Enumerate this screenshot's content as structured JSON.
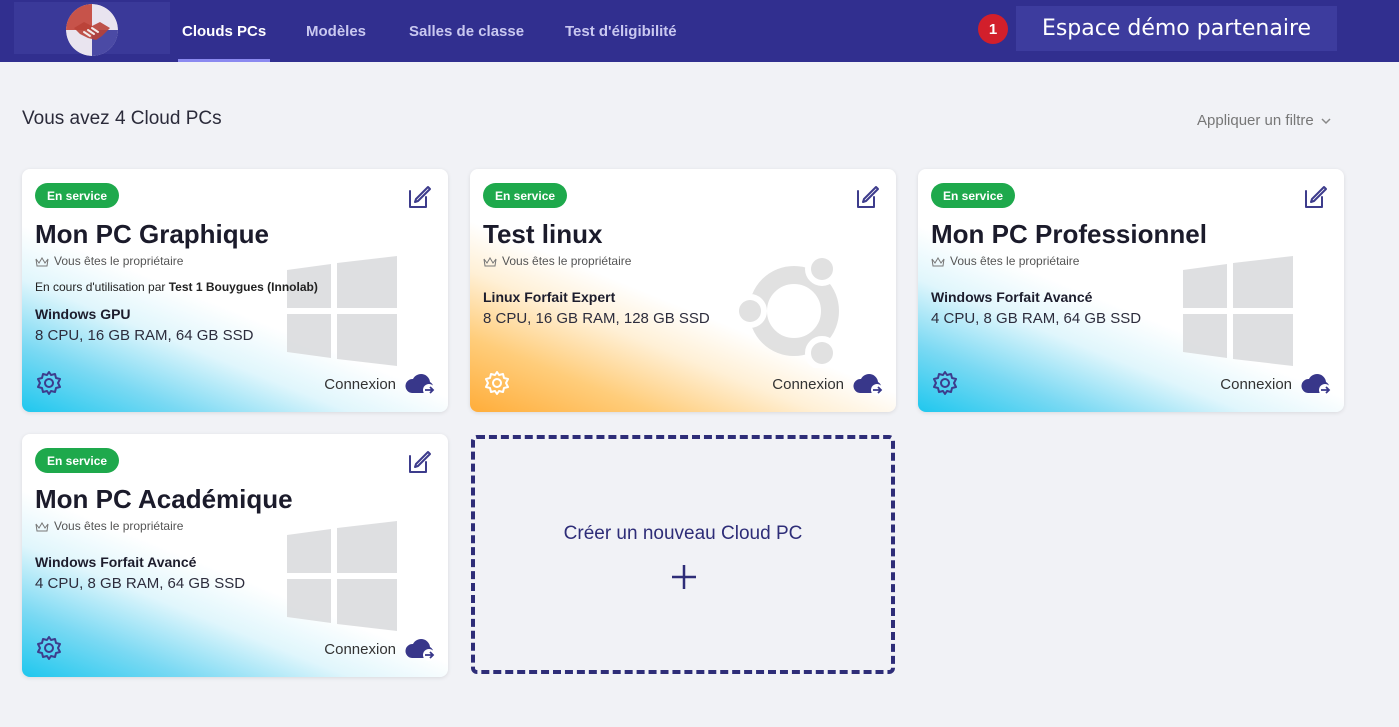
{
  "nav": {
    "items": [
      "Clouds PCs",
      "Modèles",
      "Salles de classe",
      "Test d'éligibilité"
    ],
    "active": 0,
    "notification_count": "1",
    "space_label": "Espace démo partenaire"
  },
  "main": {
    "count_text": "Vous avez 4 Cloud PCs",
    "filter_label": "Appliquer un filtre"
  },
  "cards": [
    {
      "status": "En service",
      "name": "Mon PC Graphique",
      "owner": "Vous êtes le propriétaire",
      "usage_prefix": "En cours d'utilisation par ",
      "usage_user": "Test 1 Bouygues (Innolab)",
      "plan": "Windows GPU",
      "spec": "8 CPU, 16 GB RAM, 64 GB SSD",
      "os_icon": "windows-icon",
      "connect": "Connexion"
    },
    {
      "status": "En service",
      "name": "Test linux",
      "owner": "Vous êtes le propriétaire",
      "plan": "Linux Forfait Expert",
      "spec": "8 CPU, 16 GB RAM, 128 GB SSD",
      "os_icon": "ubuntu-icon",
      "connect": "Connexion"
    },
    {
      "status": "En service",
      "name": "Mon PC Professionnel",
      "owner": "Vous êtes le propriétaire",
      "plan": "Windows Forfait Avancé",
      "spec": "4 CPU, 8 GB RAM, 64 GB SSD",
      "os_icon": "windows-icon",
      "connect": "Connexion"
    },
    {
      "status": "En service",
      "name": "Mon PC Académique",
      "owner": "Vous êtes le propriétaire",
      "plan": "Windows Forfait Avancé",
      "spec": "4 CPU, 8 GB RAM, 64 GB SSD",
      "os_icon": "windows-icon",
      "connect": "Connexion"
    }
  ],
  "create": {
    "label": "Créer un nouveau Cloud PC"
  },
  "colors": {
    "topbar": "#312f8f",
    "status_green": "#1ea94c",
    "accent": "#2e2d78",
    "notification": "#d21f2b"
  }
}
